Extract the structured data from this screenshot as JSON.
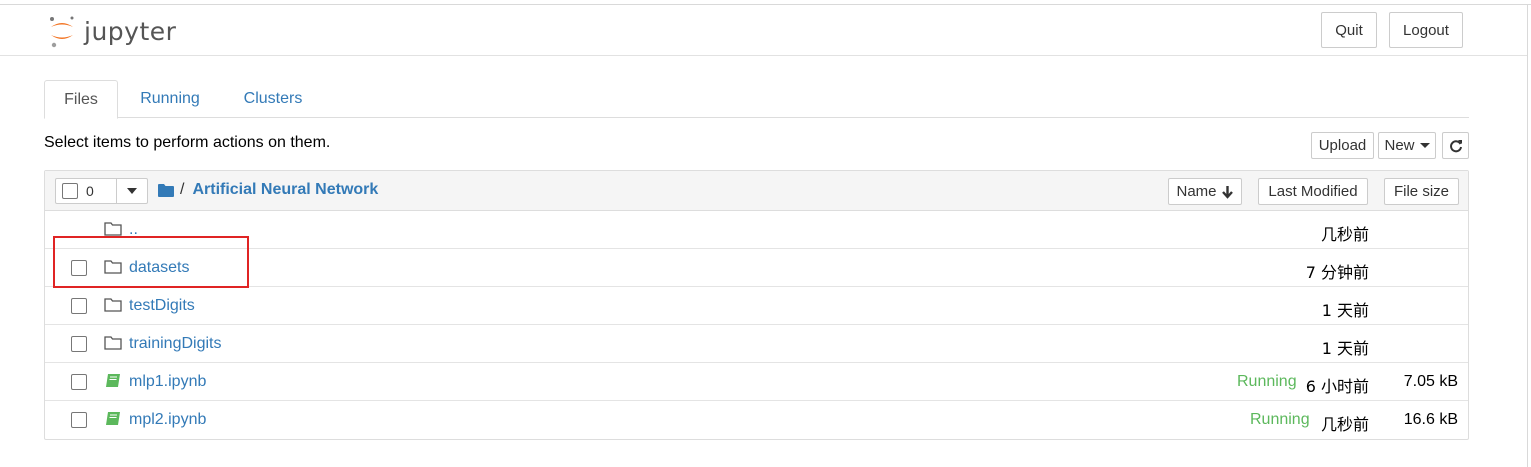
{
  "app": {
    "logo_text": "jupyter",
    "logo_icon": "jupyter-logo-icon",
    "brand_color": "#f37626"
  },
  "header": {
    "quit_label": "Quit",
    "logout_label": "Logout"
  },
  "tabs": [
    {
      "label": "Files",
      "active": true
    },
    {
      "label": "Running",
      "active": false
    },
    {
      "label": "Clusters",
      "active": false
    }
  ],
  "toolbar": {
    "instruction": "Select items to perform actions on them.",
    "upload_label": "Upload",
    "new_label": "New",
    "refresh_icon": "refresh-icon"
  },
  "list_header": {
    "selected_count": "0",
    "breadcrumb_sep": "/",
    "folder_name": "Artificial Neural Network",
    "sort_name_label": "Name",
    "sort_modified_label": "Last Modified",
    "sort_size_label": "File size"
  },
  "rows": [
    {
      "name": "..",
      "type": "folder",
      "running": "",
      "modified": "几秒前",
      "size": "",
      "has_checkbox": false
    },
    {
      "name": "datasets",
      "type": "folder",
      "running": "",
      "modified": "7 分钟前",
      "size": "",
      "has_checkbox": true
    },
    {
      "name": "testDigits",
      "type": "folder",
      "running": "",
      "modified": "1 天前",
      "size": "",
      "has_checkbox": true
    },
    {
      "name": "trainingDigits",
      "type": "folder",
      "running": "",
      "modified": "1 天前",
      "size": "",
      "has_checkbox": true
    },
    {
      "name": "mlp1.ipynb",
      "type": "notebook",
      "running": "Running",
      "modified": "6 小时前",
      "size": "7.05 kB",
      "has_checkbox": true
    },
    {
      "name": "mpl2.ipynb",
      "type": "notebook",
      "running": "Running",
      "modified": "几秒前",
      "size": "16.6 kB",
      "has_checkbox": true
    }
  ],
  "colors": {
    "link": "#337ab7",
    "running": "#5cb85c",
    "annotation_box": "#e02424"
  }
}
